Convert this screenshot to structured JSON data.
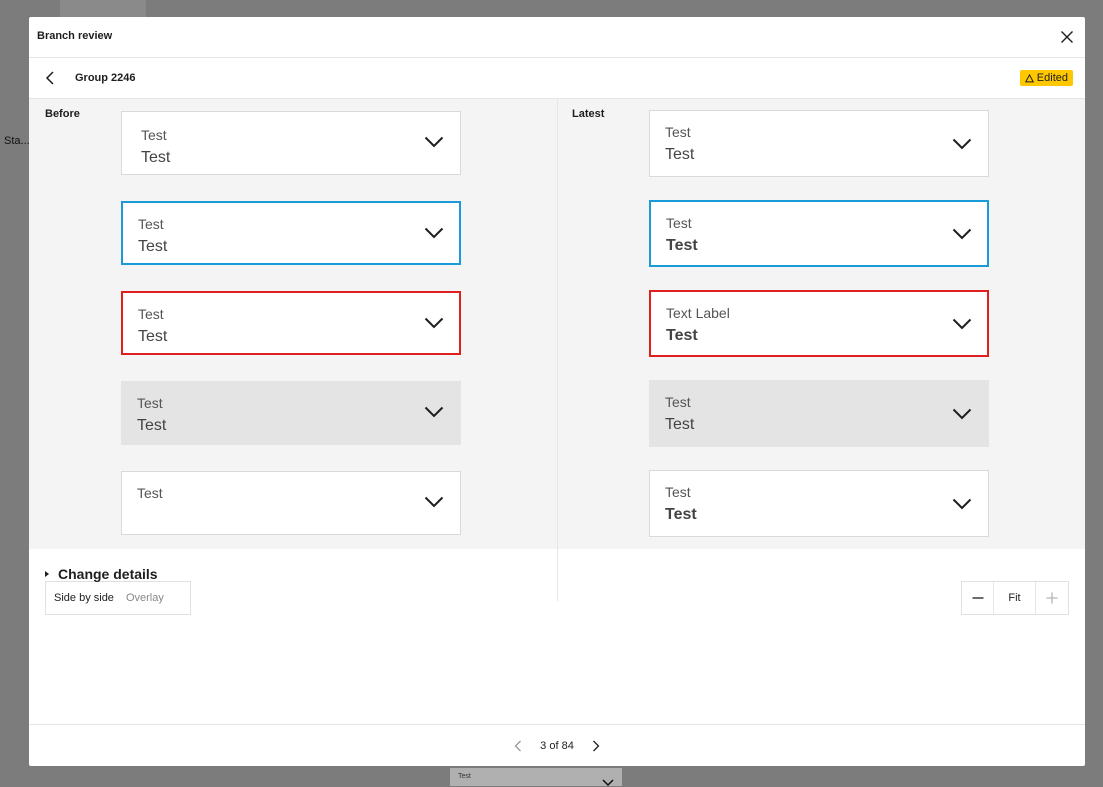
{
  "background": {
    "side_text": "Sta...",
    "bottom_card_label": "Test"
  },
  "modal": {
    "title": "Branch review",
    "close_icon": "close-icon"
  },
  "subheader": {
    "back_icon": "chevron-left-icon",
    "group_title": "Group 2246",
    "badge": {
      "icon": "warning-icon",
      "label": "Edited",
      "color": "#ffc700"
    }
  },
  "before": {
    "label": "Before",
    "fields": [
      {
        "label": "Test",
        "value": "Test",
        "state": "default"
      },
      {
        "label": "Test",
        "value": "Test",
        "state": "focus"
      },
      {
        "label": "Test",
        "value": "Test",
        "state": "error"
      },
      {
        "label": "Test",
        "value": "Test",
        "state": "disabled"
      },
      {
        "label": "Test",
        "value": "",
        "state": "default"
      }
    ]
  },
  "latest": {
    "label": "Latest",
    "fields": [
      {
        "label": "Test",
        "value": "Test",
        "state": "default"
      },
      {
        "label": "Test",
        "value": "Test",
        "state": "focus"
      },
      {
        "label": "Text Label",
        "value": "Test",
        "state": "error"
      },
      {
        "label": "Test",
        "value": "Test",
        "state": "disabled"
      },
      {
        "label": "Test",
        "value": "Test",
        "state": "default"
      }
    ]
  },
  "colors": {
    "focus": "#1a9bd7",
    "error": "#e0201e",
    "disabled_bg": "#e4e4e4"
  },
  "view_toggle": {
    "side_by_side": "Side by side",
    "overlay": "Overlay",
    "selected": "Side by side"
  },
  "zoom": {
    "minus_icon": "minus-icon",
    "fit_label": "Fit",
    "plus_icon": "plus-icon"
  },
  "change_details": {
    "label": "Change details"
  },
  "pagination": {
    "text": "3 of 84",
    "prev_icon": "chevron-left-icon",
    "next_icon": "chevron-right-icon"
  }
}
